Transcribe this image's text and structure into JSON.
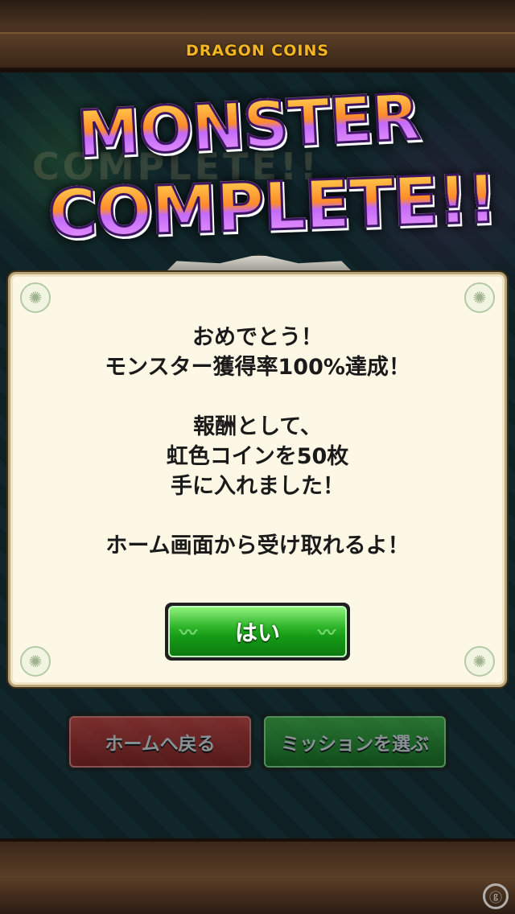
{
  "header": {
    "brand_logo": "DRAGON COINS"
  },
  "headline": {
    "line1": "MONSTER",
    "line2": "COMPLETE!!",
    "background_text": "COMPLETE!!"
  },
  "dialog": {
    "message": "おめでとう！\nモンスター獲得率100%達成！\n\n報酬として、\n虹色コインを50枚\n手に入れました！\n\nホーム画面から受け取れるよ！",
    "ok_button_label": "はい",
    "ok_ornament": "〰"
  },
  "background_buttons": {
    "home_label": "ホームへ戻る",
    "mission_label": "ミッションを選ぶ"
  },
  "icons": {
    "corner_ornament": "✺",
    "watermark": "ⓖ"
  },
  "colors": {
    "dialog_bg": "#fdf8e6",
    "ok_button": "#2fb52a",
    "home_button": "#d23a34",
    "mission_button": "#3fb53c",
    "logo_gold": "#f2b623"
  }
}
